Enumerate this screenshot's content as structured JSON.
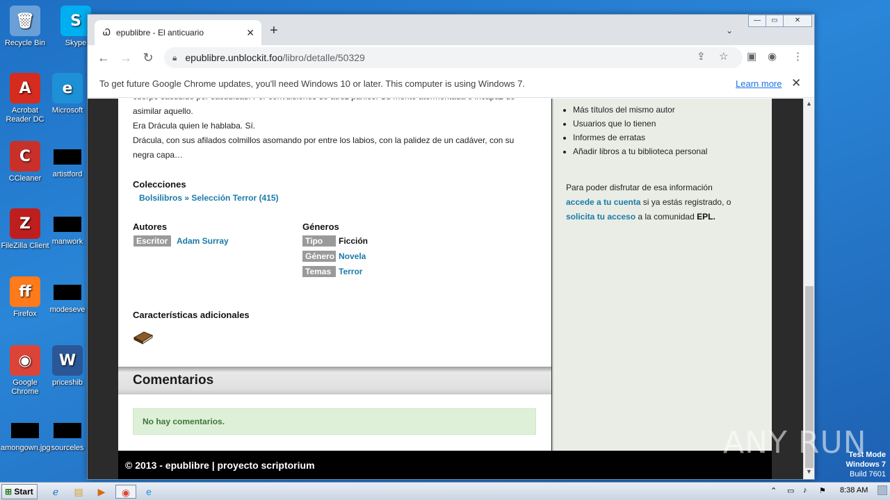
{
  "desktop": {
    "icons": [
      {
        "label": "Recycle Bin",
        "glyph": "🗑",
        "color": "#6aa0d8"
      },
      {
        "label": "Skype",
        "glyph": "S",
        "color": "#00aff0"
      },
      {
        "label": "Acrobat Reader DC",
        "glyph": "A",
        "color": "#d62b1f"
      },
      {
        "label": "Microsoft",
        "glyph": "e",
        "color": "#1e90d6"
      },
      {
        "label": "CCleaner",
        "glyph": "C",
        "color": "#c8302a"
      },
      {
        "label": "artistford",
        "glyph": "",
        "color": ""
      },
      {
        "label": "FileZilla Client",
        "glyph": "Z",
        "color": "#bf1e1e"
      },
      {
        "label": "manwork",
        "glyph": "",
        "color": ""
      },
      {
        "label": "Firefox",
        "glyph": "ff",
        "color": "#ff7a1a"
      },
      {
        "label": "modeseve",
        "glyph": "",
        "color": ""
      },
      {
        "label": "Google Chrome",
        "glyph": "◉",
        "color": "#db4437"
      },
      {
        "label": "priceshib",
        "glyph": "W",
        "color": "#2b5797"
      },
      {
        "label": "amongown.jpg",
        "glyph": "",
        "color": ""
      },
      {
        "label": "sourceles",
        "glyph": "",
        "color": ""
      }
    ]
  },
  "browser": {
    "tab_title": "epublibre - El anticuario",
    "tab_favicon": "Ꮗ",
    "url_host": "epublibre.unblockit.foo",
    "url_path": "/libro/detalle/50329",
    "infobar_text": "To get future Google Chrome updates, you'll need Windows 10 or later. This computer is using Windows 7.",
    "infobar_link": "Learn more"
  },
  "page": {
    "synopsis_lines": [
      "cuerpo sacudido por sacudidas. Por convulsiones de atroz pánico. Su mente atormentada e incapaz de",
      "asimilar aquello.",
      "Era Drácula quien le hablaba. Sí.",
      "Drácula, con sus afilados colmillos asomando por entre los labios, con la palidez de un cadáver, con su",
      "negra capa…"
    ],
    "collections_heading": "Colecciones",
    "collection_link": "Bolsilibros » Selección Terror (415)",
    "authors_heading": "Autores",
    "author_role": "Escritor",
    "author_name": "Adam Surray",
    "genres_heading": "Géneros",
    "genres": [
      {
        "tag": "Tipo",
        "value": "Ficción",
        "link": false
      },
      {
        "tag": "Género",
        "value": "Novela",
        "link": true
      },
      {
        "tag": "Temas",
        "value": "Terror",
        "link": true
      }
    ],
    "extra_heading": "Características adicionales",
    "comments_heading": "Comentarios",
    "no_comments": "No hay comentarios.",
    "footer": "© 2013 - epublibre | proyecto scriptorium",
    "side_list": [
      "Más títulos del mismo autor",
      "Usuarios que lo tienen",
      "Informes de erratas",
      "Añadir libros a tu biblioteca personal"
    ],
    "side_p1": "Para poder disfrutar de esa información",
    "side_login_link": "accede a tu cuenta",
    "side_p2": " si ya estás registrado, o",
    "side_signup_link": "solicita tu acceso",
    "side_p3": " a la comunidad ",
    "side_epl": "EPL."
  },
  "overlay": {
    "watermark": "ANY RUN",
    "testmode_1": "Test Mode",
    "testmode_2": "Windows 7",
    "testmode_3": "Build 7601"
  },
  "taskbar": {
    "start_label": "Start",
    "clock": "8:38 AM"
  }
}
